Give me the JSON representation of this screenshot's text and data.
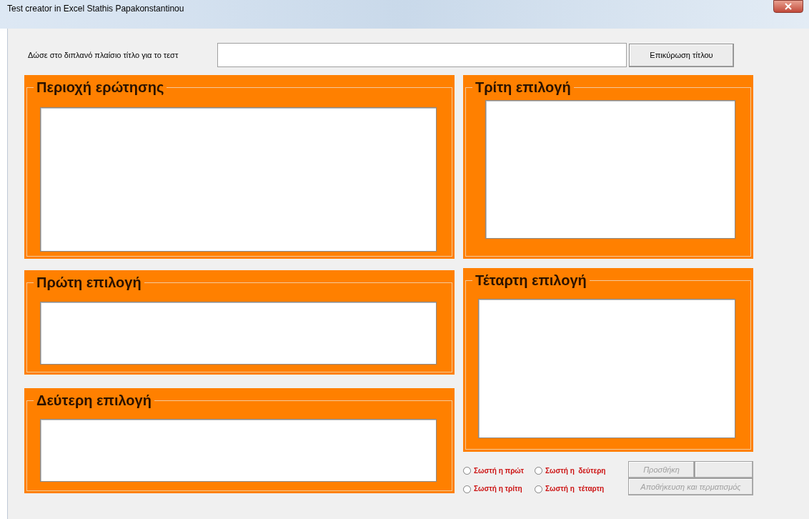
{
  "window": {
    "title": "Test creator in Excel  Stathis Papakonstantinou"
  },
  "title_row": {
    "label": "Δώσε στο  διπλανό πλαίσιο τίτλο για το τεστ",
    "button": "Επικύρωση τίτλου"
  },
  "frames": [
    {
      "title": "Περιοχή ερώτησης"
    },
    {
      "title": "Πρώτη επιλογή"
    },
    {
      "title": "Δεύτερη επιλογή"
    },
    {
      "title": "Τρίτη επιλογή"
    },
    {
      "title": "Τέταρτη επιλογή"
    }
  ],
  "radios": [
    {
      "label": "Σωστή η πρώτ",
      "selected": false
    },
    {
      "label": "Σωστή η  δεύτερη",
      "selected": false
    },
    {
      "label": "Σωστή η τρίτη",
      "selected": false
    },
    {
      "label": "Σωστή η  τέταρτη",
      "selected": false
    }
  ],
  "buttons": [
    {
      "label": "Προσθήκη",
      "disabled": true
    },
    {
      "label": "Αποθήκευση και τερματισμός",
      "disabled": true
    }
  ]
}
